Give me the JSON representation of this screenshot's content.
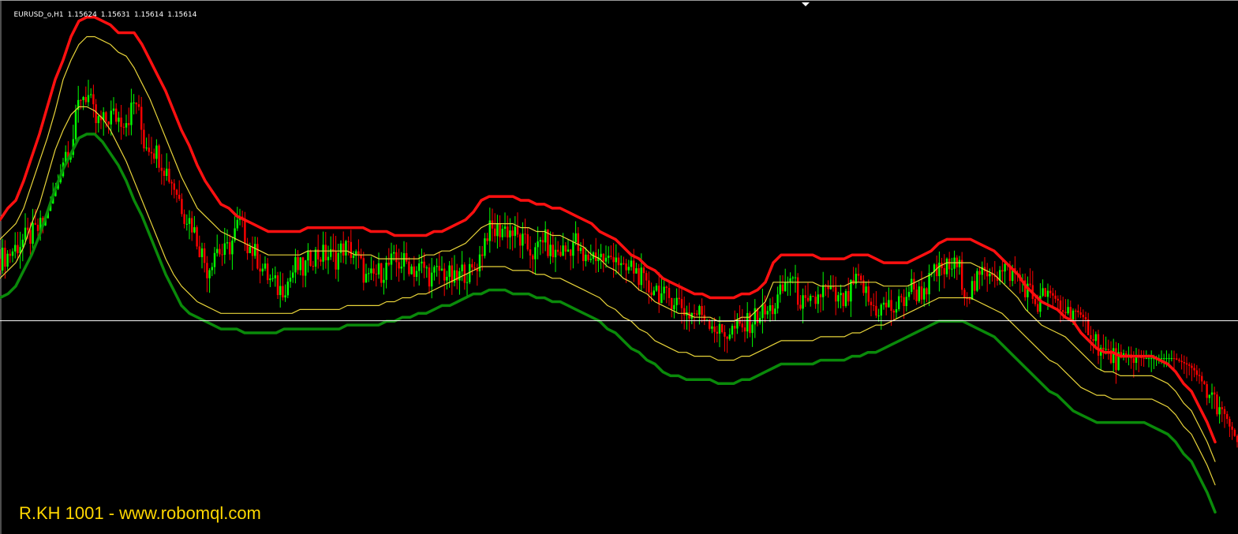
{
  "header": {
    "symbol": "EURUSD_o,H1",
    "open": "1.15624",
    "high": "1.15631",
    "low": "1.15614",
    "close": "1.15614"
  },
  "watermark": "R.KH 1001 - www.robomql.com",
  "colors": {
    "background": "#000000",
    "bull": "#00FF00",
    "bear": "#FF0000",
    "wick": "#C0C0C0",
    "upper_outer": "#FF1010",
    "lower_outer": "#0A8A0A",
    "inner_bands": "#E8D43A",
    "price_line": "#FFFFFF",
    "watermark": "#FFD700"
  },
  "chart_data": {
    "type": "line",
    "x": [
      0,
      10,
      20,
      30,
      40,
      50,
      60,
      70,
      80,
      90,
      100,
      110,
      120,
      130,
      140,
      150,
      160,
      170,
      180,
      190,
      200,
      210,
      220,
      230,
      240,
      250,
      260,
      270,
      280,
      290,
      300,
      310,
      320,
      330,
      340,
      350,
      360,
      370,
      380,
      390,
      400,
      410,
      420,
      430,
      440,
      450,
      460,
      470,
      480,
      490,
      500,
      510,
      520,
      530,
      540,
      550,
      560,
      570,
      580,
      590,
      600,
      610,
      620,
      630,
      640,
      650,
      660,
      670,
      680,
      690,
      700,
      710,
      720,
      730,
      740,
      750,
      760,
      770,
      780,
      790,
      800,
      810,
      820,
      830,
      840,
      850,
      860,
      870,
      880,
      890,
      900,
      910,
      920,
      930,
      940,
      950,
      960,
      970,
      980,
      990,
      1000,
      1010,
      1020,
      1030,
      1040,
      1050,
      1060,
      1070,
      1080,
      1090,
      1100,
      1110,
      1120,
      1130,
      1140,
      1150,
      1160,
      1170,
      1180,
      1190,
      1200,
      1210,
      1220,
      1230,
      1240,
      1250,
      1260,
      1270,
      1280,
      1290,
      1300,
      1310,
      1320,
      1330,
      1340,
      1350,
      1360,
      1370,
      1380,
      1390,
      1400,
      1410,
      1420,
      1430,
      1440,
      1450,
      1460,
      1470,
      1480,
      1490,
      1500,
      1510,
      1520,
      1530,
      1540,
      1550,
      1560,
      1569
    ],
    "series": [
      {
        "role": "price",
        "values": [
          1.1579,
          1.158,
          1.1582,
          1.1584,
          1.1585,
          1.1587,
          1.1586,
          1.1593,
          1.1606,
          1.1608,
          1.1621,
          1.1621,
          1.1614,
          1.1614,
          1.1616,
          1.1615,
          1.1615,
          1.162,
          1.1609,
          1.1608,
          1.1605,
          1.1601,
          1.1597,
          1.1591,
          1.1588,
          1.1582,
          1.1576,
          1.1582,
          1.158,
          1.1583,
          1.1589,
          1.1583,
          1.158,
          1.1576,
          1.1573,
          1.1571,
          1.1573,
          1.1577,
          1.1576,
          1.158,
          1.158,
          1.158,
          1.1579,
          1.1582,
          1.1581,
          1.1578,
          1.1573,
          1.1575,
          1.1576,
          1.1578,
          1.1578,
          1.1578,
          1.1576,
          1.1577,
          1.1574,
          1.1576,
          1.1575,
          1.1573,
          1.1576,
          1.1575,
          1.1579,
          1.1586,
          1.1586,
          1.1587,
          1.1586,
          1.1584,
          1.1582,
          1.158,
          1.1585,
          1.158,
          1.1581,
          1.1581,
          1.1584,
          1.1578,
          1.158,
          1.158,
          1.1578,
          1.1581,
          1.1575,
          1.1577,
          1.1575,
          1.1571,
          1.1572,
          1.1569,
          1.1569,
          1.1568,
          1.1565,
          1.1565,
          1.1565,
          1.1563,
          1.156,
          1.156,
          1.1561,
          1.1561,
          1.1563,
          1.1565,
          1.1565,
          1.1567,
          1.1571,
          1.1575,
          1.1569,
          1.1566,
          1.1568,
          1.1571,
          1.157,
          1.1568,
          1.1568,
          1.1573,
          1.1572,
          1.1567,
          1.1566,
          1.1567,
          1.1566,
          1.1568,
          1.1572,
          1.157,
          1.1572,
          1.1575,
          1.1576,
          1.1577,
          1.1577,
          1.157,
          1.1572,
          1.1575,
          1.1577,
          1.1575,
          1.1576,
          1.1575,
          1.1573,
          1.157,
          1.1567,
          1.1571,
          1.1569,
          1.1566,
          1.1566,
          1.1568,
          1.1563,
          1.1559,
          1.1555,
          1.1554,
          1.1553,
          1.1552,
          1.1555,
          1.1558,
          1.1559,
          1.156,
          1.1561,
          1.1558,
          1.1555,
          1.1551,
          1.1549,
          1.1545,
          1.1543,
          1.154,
          1.1537,
          1.15614
        ]
      },
      {
        "role": "upper_outer",
        "values": [
          1.1589,
          1.1592,
          1.1594,
          1.1599,
          1.1605,
          1.1611,
          1.1618,
          1.1625,
          1.163,
          1.1636,
          1.164,
          1.1641,
          1.1641,
          1.164,
          1.1639,
          1.1637,
          1.1637,
          1.1637,
          1.1634,
          1.163,
          1.1626,
          1.1622,
          1.1617,
          1.1612,
          1.1608,
          1.1603,
          1.1599,
          1.1596,
          1.1593,
          1.1592,
          1.159,
          1.1589,
          1.1588,
          1.1587,
          1.1586,
          1.1586,
          1.1586,
          1.1586,
          1.1586,
          1.1587,
          1.1587,
          1.1587,
          1.1587,
          1.1587,
          1.1587,
          1.1587,
          1.1587,
          1.1586,
          1.1586,
          1.1586,
          1.1585,
          1.1585,
          1.1585,
          1.1585,
          1.1585,
          1.1586,
          1.1586,
          1.1587,
          1.1588,
          1.1589,
          1.1591,
          1.1594,
          1.1595,
          1.1595,
          1.1595,
          1.1595,
          1.1594,
          1.1594,
          1.1593,
          1.1593,
          1.1592,
          1.1592,
          1.1591,
          1.159,
          1.1589,
          1.1588,
          1.1586,
          1.1585,
          1.1584,
          1.1582,
          1.158,
          1.1579,
          1.1577,
          1.1576,
          1.1574,
          1.1573,
          1.1572,
          1.1571,
          1.157,
          1.157,
          1.1569,
          1.1569,
          1.1569,
          1.1569,
          1.157,
          1.157,
          1.1571,
          1.1573,
          1.1578,
          1.158,
          1.158,
          1.158,
          1.158,
          1.158,
          1.1579,
          1.1579,
          1.1579,
          1.1579,
          1.158,
          1.158,
          1.158,
          1.1579,
          1.1578,
          1.1578,
          1.1578,
          1.1578,
          1.1579,
          1.158,
          1.1581,
          1.1583,
          1.1584,
          1.1584,
          1.1584,
          1.1584,
          1.1583,
          1.1582,
          1.1581,
          1.1579,
          1.1577,
          1.1575,
          1.1572,
          1.157,
          1.1568,
          1.1567,
          1.1566,
          1.1564,
          1.1563,
          1.156,
          1.1558,
          1.1556,
          1.1555,
          1.1555,
          1.1554,
          1.1554,
          1.1554,
          1.1554,
          1.1554,
          1.1553,
          1.1552,
          1.155,
          1.1547,
          1.1545,
          1.1541,
          1.1537,
          1.1532
        ]
      },
      {
        "role": "upper_inner",
        "values": [
          1.1584,
          1.1586,
          1.1588,
          1.1592,
          1.1598,
          1.1604,
          1.161,
          1.1617,
          1.1625,
          1.163,
          1.1634,
          1.1636,
          1.1636,
          1.1635,
          1.1634,
          1.1632,
          1.1631,
          1.1628,
          1.1624,
          1.162,
          1.1615,
          1.161,
          1.1605,
          1.16,
          1.1596,
          1.1592,
          1.159,
          1.1588,
          1.1586,
          1.1585,
          1.1584,
          1.1583,
          1.1582,
          1.1581,
          1.158,
          1.158,
          1.158,
          1.158,
          1.158,
          1.1581,
          1.1581,
          1.1581,
          1.1581,
          1.1581,
          1.1581,
          1.158,
          1.158,
          1.158,
          1.1579,
          1.1579,
          1.1579,
          1.1579,
          1.1579,
          1.1579,
          1.158,
          1.158,
          1.1581,
          1.1581,
          1.1582,
          1.1583,
          1.1585,
          1.1587,
          1.1588,
          1.1588,
          1.1588,
          1.1588,
          1.1587,
          1.1587,
          1.1586,
          1.1586,
          1.1585,
          1.1585,
          1.1584,
          1.1583,
          1.1582,
          1.158,
          1.1579,
          1.1577,
          1.1576,
          1.1574,
          1.1573,
          1.1571,
          1.157,
          1.1568,
          1.1567,
          1.1566,
          1.1565,
          1.1565,
          1.1564,
          1.1564,
          1.1564,
          1.1563,
          1.1563,
          1.1563,
          1.1564,
          1.1564,
          1.1566,
          1.1568,
          1.1573,
          1.1573,
          1.1573,
          1.1573,
          1.1573,
          1.1573,
          1.1572,
          1.1572,
          1.1572,
          1.1572,
          1.1573,
          1.1573,
          1.1573,
          1.1573,
          1.1572,
          1.1572,
          1.1572,
          1.1572,
          1.1573,
          1.1574,
          1.1575,
          1.1577,
          1.1578,
          1.1578,
          1.1578,
          1.1578,
          1.1577,
          1.1576,
          1.1575,
          1.1573,
          1.1571,
          1.1569,
          1.1566,
          1.1564,
          1.1562,
          1.1561,
          1.156,
          1.1559,
          1.1557,
          1.1555,
          1.1553,
          1.1551,
          1.155,
          1.155,
          1.1549,
          1.1549,
          1.1549,
          1.1549,
          1.1549,
          1.1548,
          1.1547,
          1.1545,
          1.1542,
          1.154,
          1.1536,
          1.1532,
          1.1527
        ]
      },
      {
        "role": "lower_inner",
        "values": [
          1.1574,
          1.1576,
          1.1578,
          1.1582,
          1.1588,
          1.1593,
          1.16,
          1.1607,
          1.1612,
          1.1616,
          1.1618,
          1.1618,
          1.1617,
          1.1615,
          1.1612,
          1.1608,
          1.1604,
          1.1599,
          1.1594,
          1.1589,
          1.1584,
          1.1579,
          1.1575,
          1.1572,
          1.157,
          1.1568,
          1.1567,
          1.1566,
          1.1565,
          1.1565,
          1.1565,
          1.1565,
          1.1565,
          1.1565,
          1.1565,
          1.1565,
          1.1565,
          1.1565,
          1.1566,
          1.1566,
          1.1566,
          1.1566,
          1.1566,
          1.1566,
          1.1567,
          1.1567,
          1.1567,
          1.1567,
          1.1567,
          1.1568,
          1.1568,
          1.1569,
          1.1569,
          1.157,
          1.157,
          1.1571,
          1.1572,
          1.1573,
          1.1574,
          1.1575,
          1.1576,
          1.1577,
          1.1577,
          1.1577,
          1.1577,
          1.1576,
          1.1576,
          1.1576,
          1.1575,
          1.1575,
          1.1574,
          1.1574,
          1.1573,
          1.1572,
          1.1571,
          1.157,
          1.1569,
          1.1567,
          1.1566,
          1.1564,
          1.1563,
          1.1561,
          1.156,
          1.1558,
          1.1557,
          1.1556,
          1.1555,
          1.1555,
          1.1554,
          1.1554,
          1.1554,
          1.1553,
          1.1553,
          1.1553,
          1.1554,
          1.1554,
          1.1555,
          1.1556,
          1.1557,
          1.1558,
          1.1558,
          1.1558,
          1.1558,
          1.1558,
          1.1559,
          1.1559,
          1.1559,
          1.1559,
          1.156,
          1.156,
          1.1561,
          1.1562,
          1.1562,
          1.1563,
          1.1564,
          1.1565,
          1.1566,
          1.1567,
          1.1568,
          1.1569,
          1.1569,
          1.1569,
          1.1569,
          1.1569,
          1.1568,
          1.1567,
          1.1566,
          1.1565,
          1.1563,
          1.1561,
          1.1559,
          1.1557,
          1.1555,
          1.1553,
          1.1552,
          1.155,
          1.1548,
          1.1546,
          1.1545,
          1.1544,
          1.1544,
          1.1543,
          1.1543,
          1.1543,
          1.1543,
          1.1543,
          1.1543,
          1.1542,
          1.1541,
          1.1539,
          1.1536,
          1.1534,
          1.153,
          1.1526,
          1.1521
        ]
      },
      {
        "role": "lower_outer",
        "values": [
          1.1569,
          1.157,
          1.1572,
          1.1576,
          1.158,
          1.1585,
          1.1591,
          1.1597,
          1.1602,
          1.1606,
          1.161,
          1.1611,
          1.1611,
          1.1609,
          1.1606,
          1.1603,
          1.1599,
          1.1594,
          1.159,
          1.1585,
          1.158,
          1.1575,
          1.1571,
          1.1567,
          1.1565,
          1.1564,
          1.1563,
          1.1562,
          1.1561,
          1.1561,
          1.1561,
          1.156,
          1.156,
          1.156,
          1.156,
          1.156,
          1.1561,
          1.1561,
          1.1561,
          1.1561,
          1.1561,
          1.1561,
          1.1561,
          1.1561,
          1.1562,
          1.1562,
          1.1562,
          1.1562,
          1.1562,
          1.1563,
          1.1563,
          1.1564,
          1.1564,
          1.1565,
          1.1565,
          1.1566,
          1.1567,
          1.1567,
          1.1568,
          1.1569,
          1.157,
          1.157,
          1.1571,
          1.1571,
          1.1571,
          1.157,
          1.157,
          1.157,
          1.1569,
          1.1569,
          1.1568,
          1.1568,
          1.1567,
          1.1566,
          1.1565,
          1.1564,
          1.1563,
          1.1561,
          1.156,
          1.1558,
          1.1556,
          1.1555,
          1.1553,
          1.1552,
          1.155,
          1.1549,
          1.1549,
          1.1548,
          1.1548,
          1.1548,
          1.1548,
          1.1547,
          1.1547,
          1.1547,
          1.1548,
          1.1548,
          1.1549,
          1.155,
          1.1551,
          1.1552,
          1.1552,
          1.1552,
          1.1552,
          1.1552,
          1.1553,
          1.1553,
          1.1553,
          1.1553,
          1.1554,
          1.1554,
          1.1555,
          1.1555,
          1.1556,
          1.1557,
          1.1558,
          1.1559,
          1.156,
          1.1561,
          1.1562,
          1.1563,
          1.1563,
          1.1563,
          1.1563,
          1.1562,
          1.1561,
          1.156,
          1.1559,
          1.1557,
          1.1555,
          1.1553,
          1.1551,
          1.1549,
          1.1547,
          1.1545,
          1.1544,
          1.1542,
          1.154,
          1.1539,
          1.1538,
          1.1537,
          1.1537,
          1.1537,
          1.1537,
          1.1537,
          1.1537,
          1.1537,
          1.1536,
          1.1535,
          1.1534,
          1.1532,
          1.1529,
          1.1527,
          1.1523,
          1.1519,
          1.1514
        ]
      }
    ],
    "ylim": [
      1.1509,
      1.1645
    ],
    "current_price": 1.15631,
    "grid": false,
    "legend": "none"
  }
}
